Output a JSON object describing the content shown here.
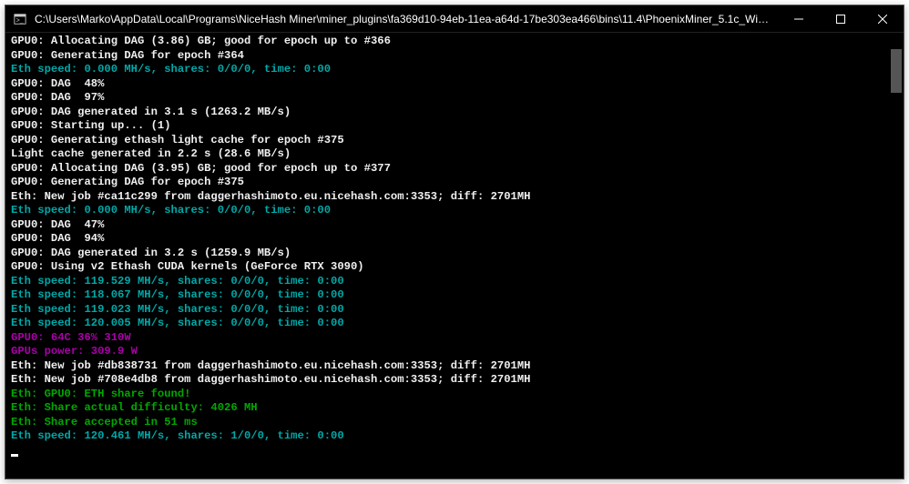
{
  "window": {
    "title": "C:\\Users\\Marko\\AppData\\Local\\Programs\\NiceHash Miner\\miner_plugins\\fa369d10-94eb-11ea-a64d-17be303ea466\\bins\\11.4\\PhoenixMiner_5.1c_Win..."
  },
  "lines": [
    {
      "color": "white",
      "text": "GPU0: Allocating DAG (3.86) GB; good for epoch up to #366"
    },
    {
      "color": "white",
      "text": "GPU0: Generating DAG for epoch #364"
    },
    {
      "color": "cyan",
      "text": "Eth speed: 0.000 MH/s, shares: 0/0/0, time: 0:00"
    },
    {
      "color": "white",
      "text": "GPU0: DAG  48%"
    },
    {
      "color": "white",
      "text": "GPU0: DAG  97%"
    },
    {
      "color": "white",
      "text": "GPU0: DAG generated in 3.1 s (1263.2 MB/s)"
    },
    {
      "color": "white",
      "text": "GPU0: Starting up... (1)"
    },
    {
      "color": "white",
      "text": "GPU0: Generating ethash light cache for epoch #375"
    },
    {
      "color": "white",
      "text": "Light cache generated in 2.2 s (28.6 MB/s)"
    },
    {
      "color": "white",
      "text": "GPU0: Allocating DAG (3.95) GB; good for epoch up to #377"
    },
    {
      "color": "white",
      "text": "GPU0: Generating DAG for epoch #375"
    },
    {
      "color": "white",
      "text": "Eth: New job #ca11c299 from daggerhashimoto.eu.nicehash.com:3353; diff: 2701MH"
    },
    {
      "color": "cyan",
      "text": "Eth speed: 0.000 MH/s, shares: 0/0/0, time: 0:00"
    },
    {
      "color": "white",
      "text": "GPU0: DAG  47%"
    },
    {
      "color": "white",
      "text": "GPU0: DAG  94%"
    },
    {
      "color": "white",
      "text": "GPU0: DAG generated in 3.2 s (1259.9 MB/s)"
    },
    {
      "color": "white",
      "text": "GPU0: Using v2 Ethash CUDA kernels (GeForce RTX 3090)"
    },
    {
      "color": "cyan",
      "text": "Eth speed: 119.529 MH/s, shares: 0/0/0, time: 0:00"
    },
    {
      "color": "cyan",
      "text": "Eth speed: 118.067 MH/s, shares: 0/0/0, time: 0:00"
    },
    {
      "color": "cyan",
      "text": "Eth speed: 119.023 MH/s, shares: 0/0/0, time: 0:00"
    },
    {
      "color": "cyan",
      "text": "Eth speed: 120.005 MH/s, shares: 0/0/0, time: 0:00"
    },
    {
      "color": "magenta",
      "text": "GPU0: 64C 36% 310W"
    },
    {
      "color": "magenta",
      "text": "GPUs power: 309.9 W"
    },
    {
      "color": "white",
      "text": "Eth: New job #db838731 from daggerhashimoto.eu.nicehash.com:3353; diff: 2701MH"
    },
    {
      "color": "white",
      "text": "Eth: New job #708e4db8 from daggerhashimoto.eu.nicehash.com:3353; diff: 2701MH"
    },
    {
      "color": "green",
      "text": "Eth: GPU0: ETH share found!"
    },
    {
      "color": "green",
      "text": "Eth: Share actual difficulty: 4026 MH"
    },
    {
      "color": "green",
      "text": "Eth: Share accepted in 51 ms"
    },
    {
      "color": "cyan",
      "text": "Eth speed: 120.461 MH/s, shares: 1/0/0, time: 0:00"
    }
  ]
}
